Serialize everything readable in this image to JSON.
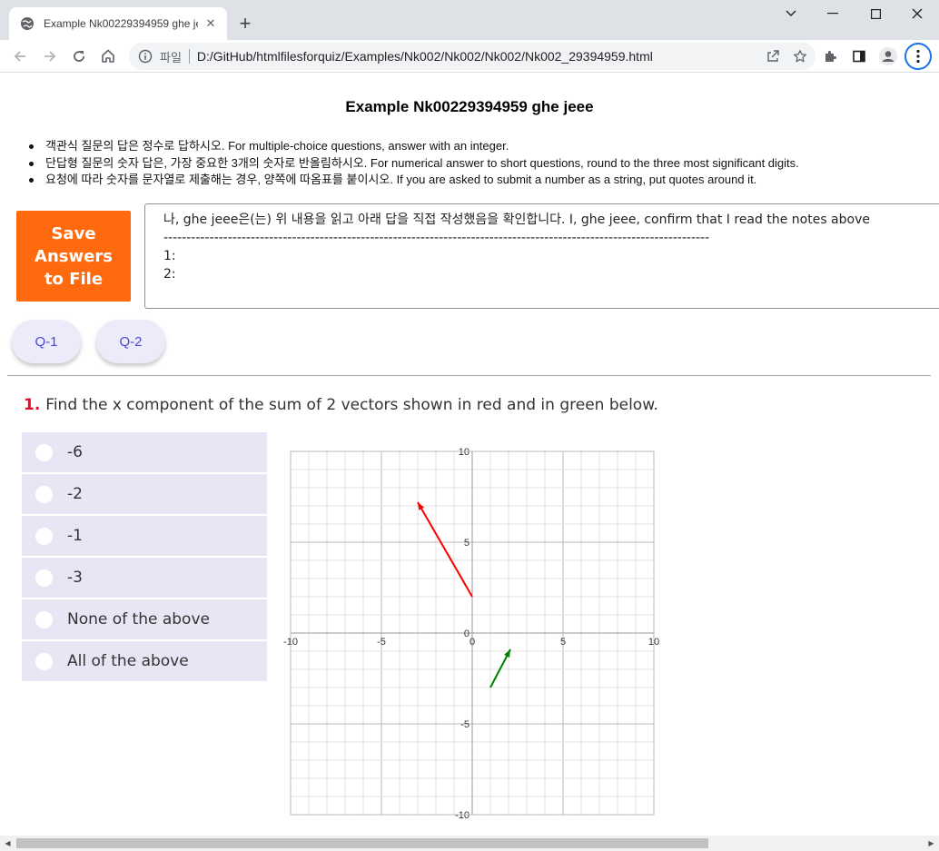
{
  "browser": {
    "tab_title": "Example Nk00229394959 ghe jeee",
    "tab_close": "✕",
    "new_tab": "+",
    "scheme_label": "파일",
    "url": "D:/GitHub/htmlfilesforquiz/Examples/Nk002/Nk002/Nk002/Nk002_29394959.html"
  },
  "page": {
    "title": "Example Nk00229394959 ghe jeee",
    "notes": [
      "객관식 질문의 답은 정수로 답하시오. For multiple-choice questions, answer with an integer.",
      "단답형 질문의 숫자 답은, 가장 중요한 3개의 숫자로 반올림하시오. For numerical answer to short questions, round to the three most significant digits.",
      "요청에 따라 숫자를 문자열로 제출해는 경우, 양쪽에 따옴표를 붙이시오. If you are asked to submit a number as a string, put quotes around it."
    ],
    "save_button": "Save Answers to File",
    "answers_text": "나, ghe jeee은(는) 위 내용을 읽고 아래 답을 직접 작성했음을 확인합니다. I, ghe jeee, confirm that I read the notes above\n-----------------------------------------------------------------------------------------------------------------------\n1:\n2:",
    "question_buttons": [
      "Q-1",
      "Q-2"
    ]
  },
  "question": {
    "number": "1.",
    "text": "Find the x component of the sum of 2 vectors shown in red and in green below.",
    "choices": [
      "-6",
      "-2",
      "-1",
      "-3",
      "None of the above",
      "All of the above"
    ]
  },
  "chart_data": {
    "type": "vector",
    "xlim": [
      -10,
      10
    ],
    "ylim": [
      -10,
      10
    ],
    "grid": true,
    "grid_step": 1,
    "x_tick_labels": [
      "-10",
      "-5",
      "0",
      "5",
      "10"
    ],
    "y_tick_labels": [
      "10",
      "5",
      "0",
      "-5",
      "-10"
    ],
    "vectors": [
      {
        "color": "#ff0000",
        "from": [
          0,
          2
        ],
        "to": [
          -3,
          7.2
        ]
      },
      {
        "color": "#008000",
        "from": [
          1,
          -3
        ],
        "to": [
          2.1,
          -0.9
        ]
      }
    ]
  }
}
